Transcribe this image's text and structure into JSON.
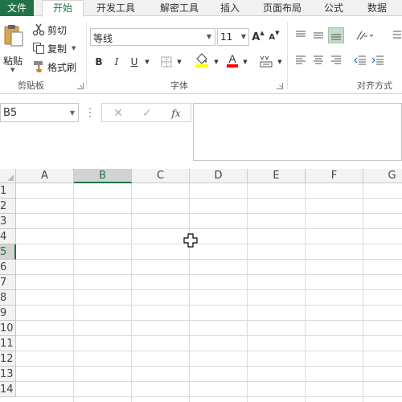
{
  "tabs": {
    "file": "文件",
    "home": "开始",
    "developer": "开发工具",
    "decrypt": "解密工具",
    "insert": "插入",
    "page_layout": "页面布局",
    "formulas": "公式",
    "data": "数据"
  },
  "clipboard": {
    "paste": "粘贴",
    "cut": "剪切",
    "copy": "复制",
    "format_painter": "格式刷",
    "group_label": "剪贴板"
  },
  "font": {
    "name": "等线",
    "size": "11",
    "bold": "B",
    "italic": "I",
    "underline": "U",
    "grow": "A",
    "shrink": "A",
    "font_color_glyph": "A",
    "group_label": "字体"
  },
  "alignment": {
    "group_label": "对齐方式"
  },
  "formula_bar": {
    "namebox": "B5",
    "cancel": "✕",
    "enter": "✓",
    "fx": "fx"
  },
  "sheet": {
    "columns": [
      "A",
      "B",
      "C",
      "D",
      "E",
      "F",
      "G"
    ],
    "rows": [
      "1",
      "2",
      "3",
      "4",
      "5",
      "6",
      "7",
      "8",
      "9",
      "10",
      "11",
      "12",
      "13",
      "14"
    ],
    "active_column": "B",
    "active_row": "5"
  },
  "colors": {
    "accent": "#217346",
    "fill_highlight": "#ffff00",
    "font_red": "#ff0000"
  }
}
